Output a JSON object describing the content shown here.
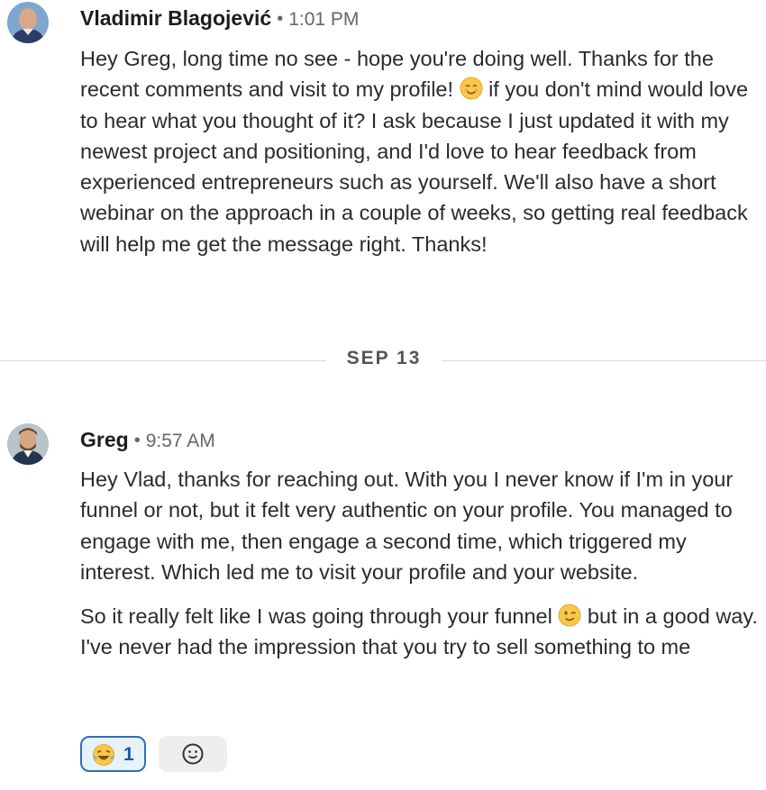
{
  "messages": [
    {
      "sender": "Vladimir Blagojević",
      "time": "1:01 PM",
      "avatar": "person-avatar-bald",
      "paragraphs": [
        "Hey Greg, long time no see - hope you're doing well. Thanks for the recent comments and visit to my profile!",
        "if you don't mind would love to hear what you thought of it? I ask because I just updated it with my newest project and positioning, and I'd love to hear feedback from experienced entrepreneurs such as yourself. We'll also have a short webinar on the approach in a couple of weeks, so getting real feedback will help me get the message right. Thanks!"
      ]
    },
    {
      "sender": "Greg",
      "time": "9:57 AM",
      "avatar": "person-avatar-beard",
      "paragraphs": [
        "Hey Vlad, thanks for reaching out. With you I never know if I'm in your funnel or not, but it felt very authentic on your profile. You managed to engage with me, then engage a second time, which triggered my interest. Which led me to visit your profile and your website.",
        "So it really felt like I was going through your funnel",
        "but in a good way. I've never had the impression that you try to sell something to me"
      ]
    }
  ],
  "date_divider": "SEP 13",
  "separator_dot": "•",
  "reactions": [
    {
      "emoji": "laughing-tears-emoji",
      "count": "1"
    },
    {
      "emoji": "add-reaction-icon"
    }
  ],
  "colors": {
    "reaction_border": "#2f6fb3",
    "reaction_bg": "#e8f2fb",
    "divider": "#d9d9d9"
  }
}
